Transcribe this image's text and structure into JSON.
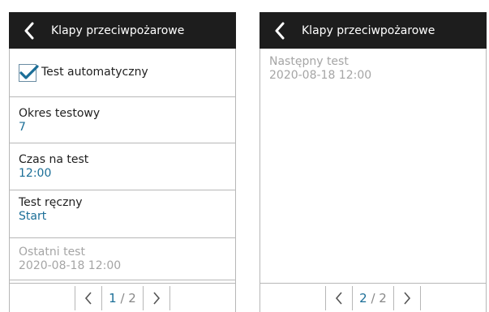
{
  "left_panel": {
    "header_title": "Klapy przeciwpożarowe",
    "auto_test_label": "Test automatyczny",
    "auto_test_checked": true,
    "okres_label": "Okres testowy",
    "okres_value": "7",
    "czas_label": "Czas na test",
    "czas_value": "12:00",
    "reczny_label": "Test ręczny",
    "reczny_value": "Start",
    "ostatni_label": "Ostatni test",
    "ostatni_value": "2020-08-18 12:00",
    "pager": {
      "current": "1",
      "separator": " / ",
      "total": "2"
    }
  },
  "right_panel": {
    "header_title": "Klapy przeciwpożarowe",
    "nastepny_label": "Następny test",
    "nastepny_value": "2020-08-18 12:00",
    "pager": {
      "current": "2",
      "separator": " / ",
      "total": "2"
    }
  },
  "colors": {
    "header_bg": "#1d1d1d",
    "accent": "#1b6e97",
    "disabled": "#a5a5a5"
  },
  "icons": {
    "back": "chevron-left-icon",
    "checkbox": "checkmark-icon",
    "prev": "chevron-left-icon",
    "next": "chevron-right-icon"
  }
}
